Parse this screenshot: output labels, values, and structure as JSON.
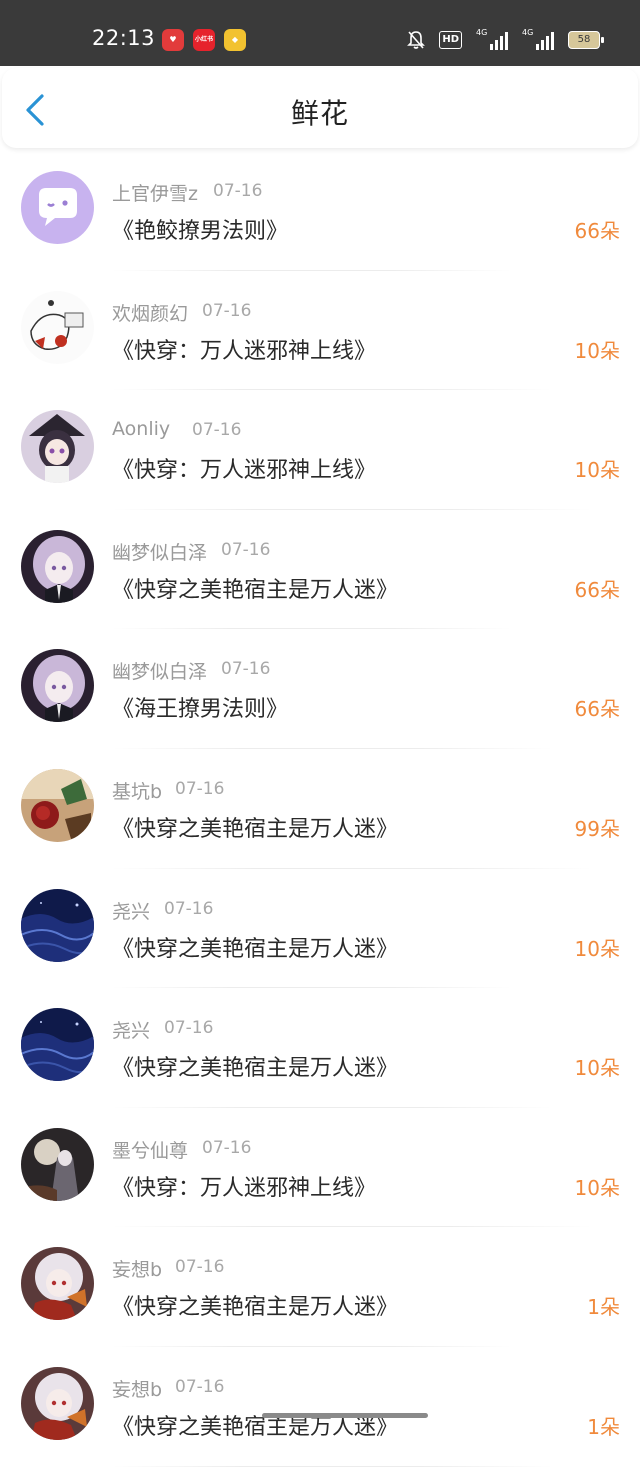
{
  "status_bar": {
    "time": "22:13",
    "apps": [
      "小红书"
    ],
    "hd": "HD",
    "network": "4G",
    "battery": "58"
  },
  "header": {
    "back_icon": "chevron-left-icon",
    "title": "鲜花",
    "accent": "#2a93d5"
  },
  "list": {
    "count_color": "#f08a3c",
    "items": [
      {
        "user": "上官伊雪z",
        "date": "07-16",
        "book": "《艳鲛撩男法则》",
        "flowers": "66朵",
        "avatar": "purple-chat"
      },
      {
        "user": "欢烟颜幻",
        "date": "07-16",
        "book": "《快穿：万人迷邪神上线》",
        "flowers": "10朵",
        "avatar": "sketch"
      },
      {
        "user": "Aonliy",
        "date": "07-16",
        "book": "《快穿：万人迷邪神上线》",
        "flowers": "10朵",
        "avatar": "anime-witch"
      },
      {
        "user": "幽梦似白泽",
        "date": "07-16",
        "book": "《快穿之美艳宿主是万人迷》",
        "flowers": "66朵",
        "avatar": "anime-silver"
      },
      {
        "user": "幽梦似白泽",
        "date": "07-16",
        "book": "《海王撩男法则》",
        "flowers": "66朵",
        "avatar": "anime-silver"
      },
      {
        "user": "基坑b",
        "date": "07-16",
        "book": "《快穿之美艳宿主是万人迷》",
        "flowers": "99朵",
        "avatar": "rose"
      },
      {
        "user": "尧兴",
        "date": "07-16",
        "book": "《快穿之美艳宿主是万人迷》",
        "flowers": "10朵",
        "avatar": "blue-sea"
      },
      {
        "user": "尧兴",
        "date": "07-16",
        "book": "《快穿之美艳宿主是万人迷》",
        "flowers": "10朵",
        "avatar": "blue-sea"
      },
      {
        "user": "墨兮仙尊",
        "date": "07-16",
        "book": "《快穿：万人迷邪神上线》",
        "flowers": "10朵",
        "avatar": "dark-moon"
      },
      {
        "user": "妄想b",
        "date": "07-16",
        "book": "《快穿之美艳宿主是万人迷》",
        "flowers": "1朵",
        "avatar": "anime-red"
      },
      {
        "user": "妄想b",
        "date": "07-16",
        "book": "《快穿之美艳宿主是万人迷》",
        "flowers": "1朵",
        "avatar": "anime-red"
      }
    ]
  }
}
